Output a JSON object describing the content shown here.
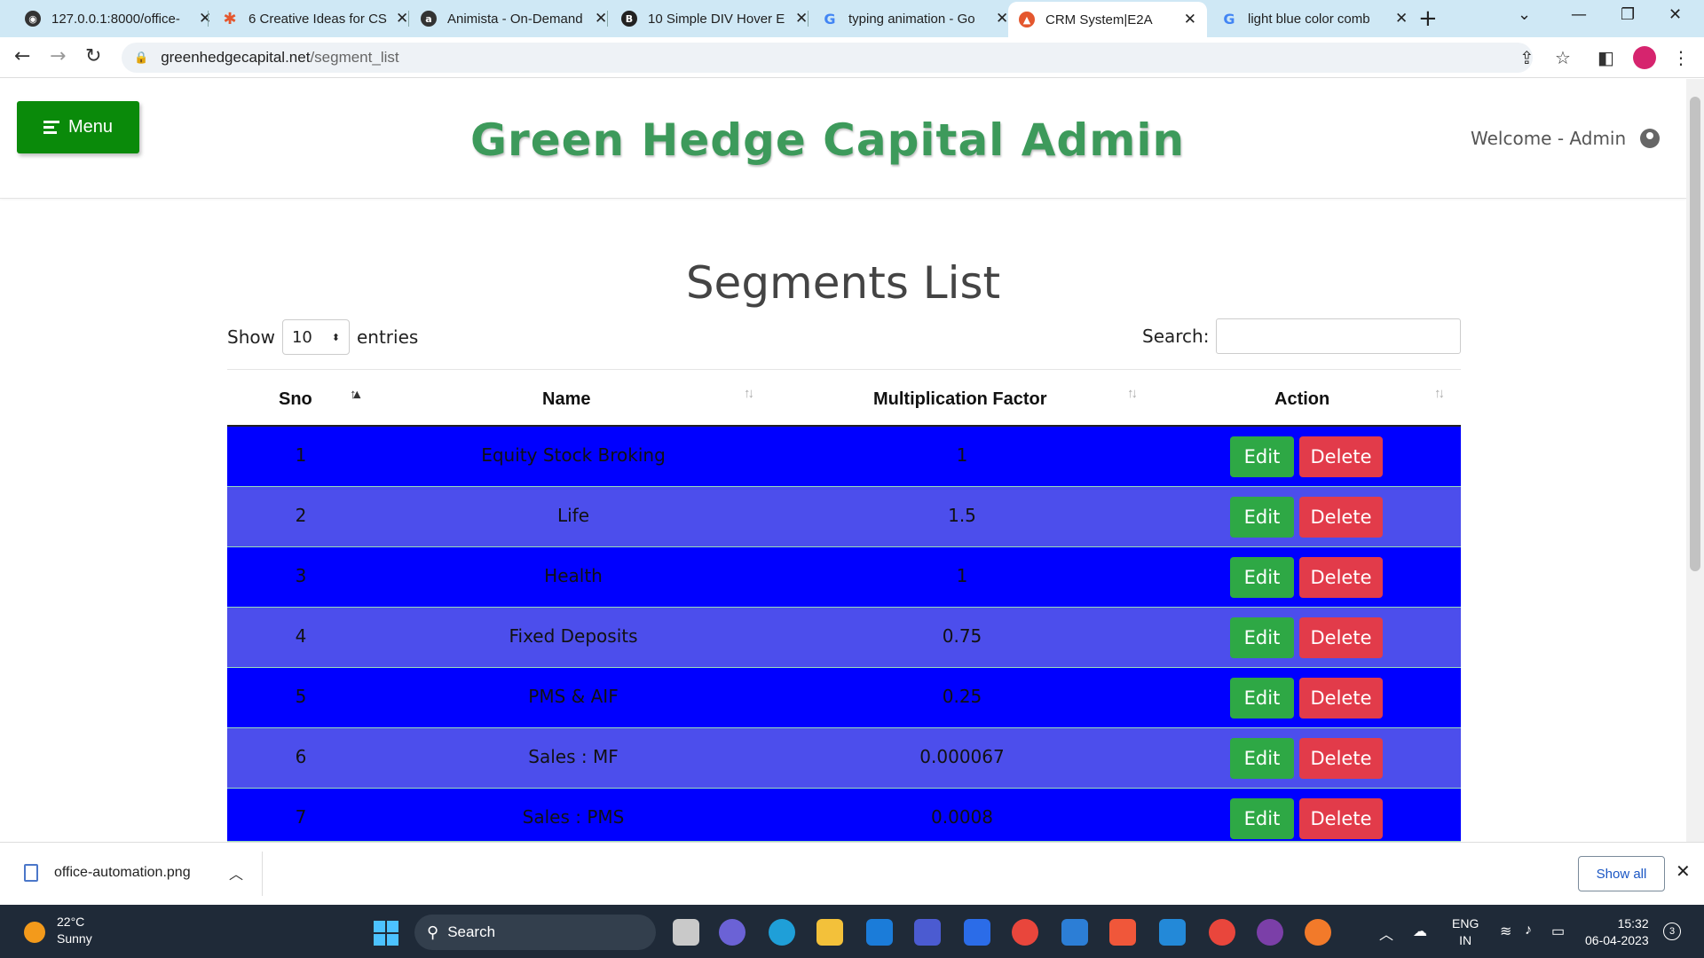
{
  "browser": {
    "tabs": [
      {
        "title": "127.0.0.1:8000/office-",
        "favicon": "globe-icon",
        "active": false
      },
      {
        "title": "6 Creative Ideas for CS",
        "favicon": "asterisk-icon",
        "active": false
      },
      {
        "title": "Animista - On-Demand",
        "favicon": "animista-icon",
        "active": false
      },
      {
        "title": "10 Simple DIV Hover E",
        "favicon": "b-icon",
        "active": false
      },
      {
        "title": "typing animation - Go",
        "favicon": "google-icon",
        "active": false
      },
      {
        "title": "CRM System|E2A",
        "favicon": "crm-icon",
        "active": true
      },
      {
        "title": "light blue color comb",
        "favicon": "google-icon",
        "active": false
      }
    ],
    "url_domain": "greenhedgecapital.net",
    "url_path": "/segment_list"
  },
  "header": {
    "menu_label": "Menu",
    "brand": "Green Hedge Capital Admin",
    "welcome": "Welcome - Admin"
  },
  "main": {
    "title": "Segments List",
    "show_label": "Show",
    "entries_value": "10",
    "entries_label": "entries",
    "search_label": "Search:",
    "search_value": "",
    "columns": [
      "Sno",
      "Name",
      "Multiplication Factor",
      "Action"
    ],
    "edit_label": "Edit",
    "delete_label": "Delete",
    "rows": [
      {
        "sno": "1",
        "name": "Equity Stock Broking",
        "factor": "1"
      },
      {
        "sno": "2",
        "name": "Life",
        "factor": "1.5"
      },
      {
        "sno": "3",
        "name": "Health",
        "factor": "1"
      },
      {
        "sno": "4",
        "name": "Fixed Deposits",
        "factor": "0.75"
      },
      {
        "sno": "5",
        "name": "PMS & AIF",
        "factor": "0.25"
      },
      {
        "sno": "6",
        "name": "Sales : MF",
        "factor": "0.000067"
      },
      {
        "sno": "7",
        "name": "Sales : PMS",
        "factor": "0.0008"
      }
    ]
  },
  "downloads": {
    "file": "office-automation.png",
    "show_all": "Show all"
  },
  "taskbar": {
    "temp": "22°C",
    "condition": "Sunny",
    "search": "Search",
    "lang_1": "ENG",
    "lang_2": "IN",
    "time": "15:32",
    "date": "06-04-2023",
    "notifications": "3"
  },
  "colors": {
    "row_dark": "#0000ff",
    "row_light": "#4c4eec",
    "edit": "#2ea845",
    "delete": "#e23b4a",
    "menu": "#0a8a0a",
    "brand": "#3d9a5b"
  }
}
